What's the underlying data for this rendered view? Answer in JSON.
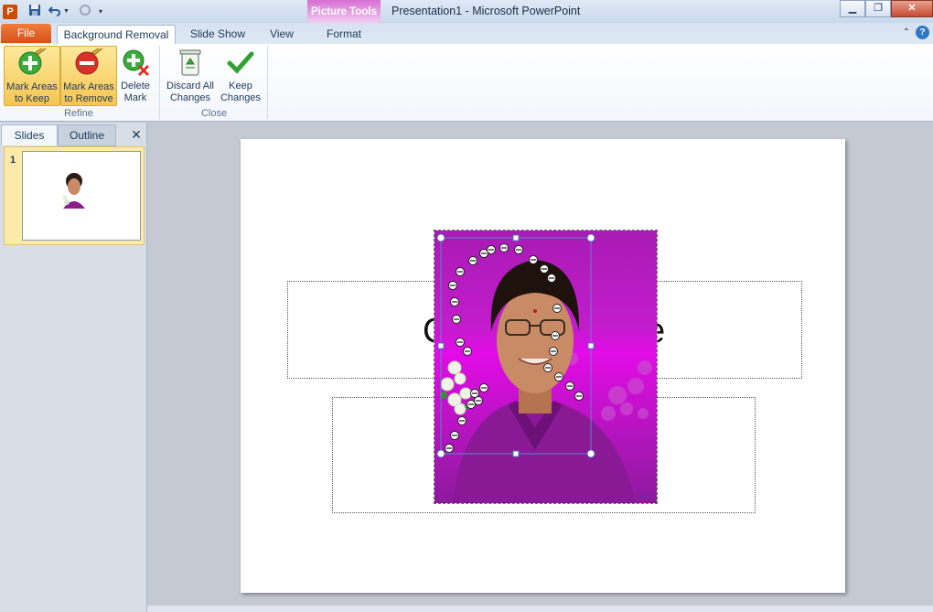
{
  "window": {
    "title": "Presentation1  -  Microsoft PowerPoint",
    "contextual_label": "Picture Tools",
    "app_icon_letter": "P"
  },
  "tabs": {
    "file": "File",
    "background_removal": "Background Removal",
    "slide_show": "Slide Show",
    "view": "View",
    "format": "Format"
  },
  "ribbon": {
    "mark_keep": "Mark Areas\nto Keep",
    "mark_remove": "Mark Areas\nto Remove",
    "delete_mark": "Delete\nMark",
    "discard": "Discard All\nChanges",
    "keep_changes": "Keep\nChanges",
    "group_refine": "Refine",
    "group_close": "Close"
  },
  "left_pane": {
    "tab_slides": "Slides",
    "tab_outline": "Outline",
    "slide_number": "1"
  },
  "slide": {
    "title_left": "C",
    "title_right": "e"
  },
  "colors": {
    "magenta": "#9a16a8",
    "accent": "#f6c551",
    "file_tab": "#d6501a"
  }
}
